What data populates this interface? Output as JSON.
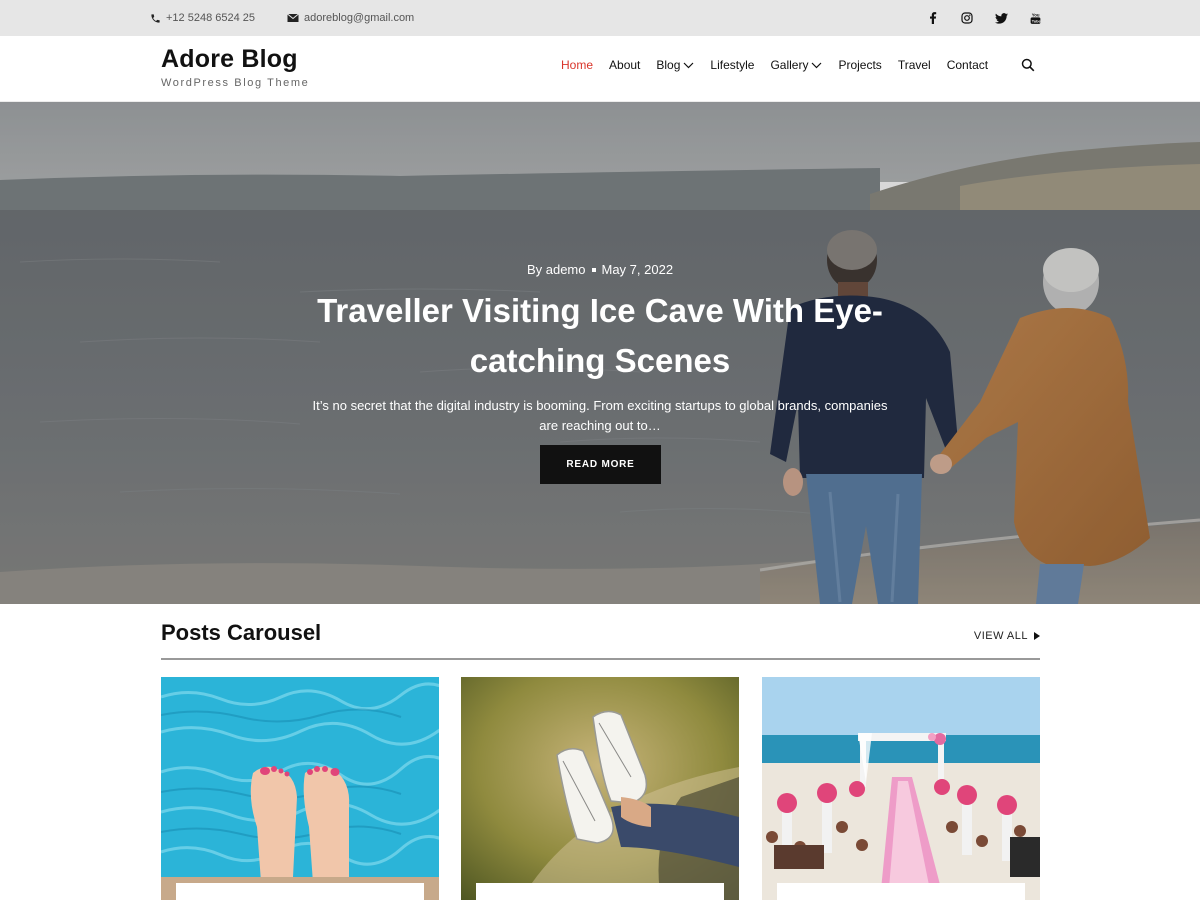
{
  "topbar": {
    "phone": "+12 5248 6524 25",
    "email": "adoreblog@gmail.com",
    "phone_icon": "phone-icon",
    "email_icon": "envelope-icon",
    "social": [
      "facebook-icon",
      "instagram-icon",
      "twitter-icon",
      "youtube-icon"
    ]
  },
  "header": {
    "site_title": "Adore Blog",
    "tagline": "WordPress Blog Theme",
    "search_icon": "search-icon"
  },
  "nav": {
    "items": [
      {
        "label": "Home",
        "active": true,
        "dropdown": false
      },
      {
        "label": "About",
        "active": false,
        "dropdown": false
      },
      {
        "label": "Blog",
        "active": false,
        "dropdown": true
      },
      {
        "label": "Lifestyle",
        "active": false,
        "dropdown": false
      },
      {
        "label": "Gallery",
        "active": false,
        "dropdown": true
      },
      {
        "label": "Projects",
        "active": false,
        "dropdown": false
      },
      {
        "label": "Travel",
        "active": false,
        "dropdown": false
      },
      {
        "label": "Contact",
        "active": false,
        "dropdown": false
      }
    ]
  },
  "hero": {
    "author": "By ademo",
    "date": "May 7, 2022",
    "title": "Traveller Visiting Ice Cave With Eye-catching Scenes",
    "excerpt": "It’s no secret that the digital industry is booming. From exciting startups to global brands, companies are reaching out to…",
    "button": "READ MORE"
  },
  "carousel": {
    "title": "Posts Carousel",
    "view_all": "VIEW ALL",
    "cards": [
      "pool-feet-image",
      "sneakers-image",
      "beach-wedding-image"
    ]
  },
  "colors": {
    "accent": "#d9352b",
    "topbar_bg": "#e6e6e6",
    "button_bg": "#111111"
  }
}
